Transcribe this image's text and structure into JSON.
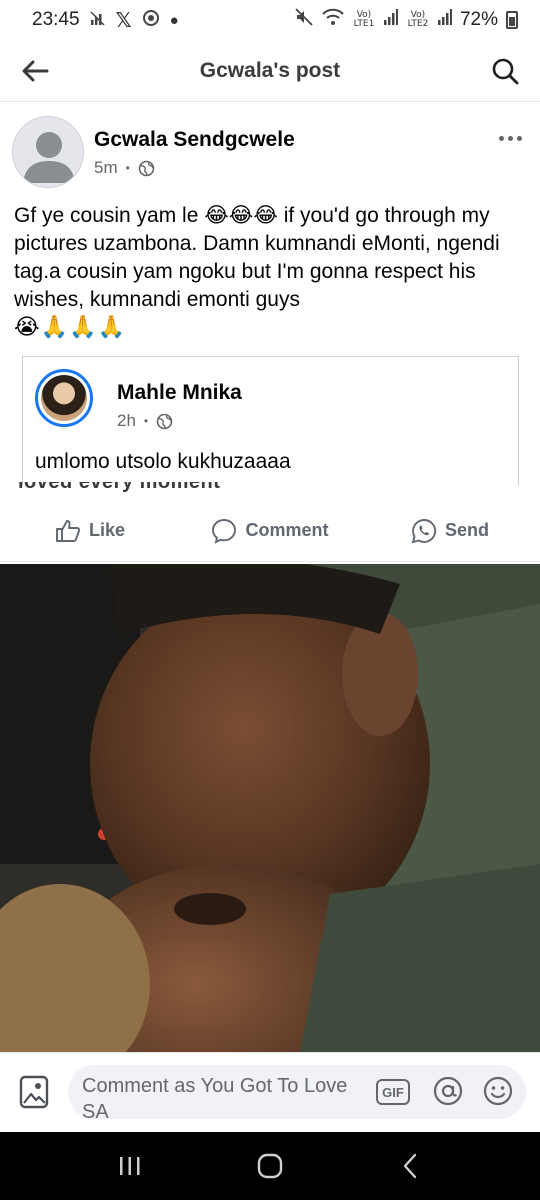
{
  "status_bar": {
    "time": "23:45",
    "battery": "72%",
    "signal1": "Vo) LTE1",
    "signal2": "Vo) LTE2",
    "left_icons": [
      "signal-off-icon",
      "x-logo-icon",
      "gallery-icon",
      "dot-icon"
    ],
    "right_icons": [
      "mute-icon",
      "wifi-icon",
      "signal-icon",
      "battery-icon"
    ]
  },
  "header": {
    "title": "Gcwala's post",
    "back_icon": "back-arrow-icon",
    "search_icon": "search-icon"
  },
  "post": {
    "author": "Gcwala Sendgcwele",
    "time": "5m",
    "separator": "•",
    "privacy_icon": "globe-icon",
    "text": "Gf ye cousin yam le 😂😂😂 if you'd go through my pictures uzambona. Damn kumnandi eMonti, ngendi tag.a cousin yam ngoku but I'm gonna respect his wishes, kumnandi emonti guys",
    "emojis": "😭🙏🙏🙏"
  },
  "shared_post": {
    "author": "Mahle Mnika",
    "time": "2h",
    "separator": "•",
    "text": "umlomo utsolo kukhuzaaaa",
    "cut_text": "loved every moment"
  },
  "actions": {
    "like": "Like",
    "comment": "Comment",
    "send": "Send"
  },
  "comment_bar": {
    "placeholder": "Comment as You Got To Love SA",
    "gif": "GIF"
  },
  "nav": {
    "recents_icon": "recents-icon",
    "home_icon": "home-icon",
    "back_icon": "nav-back-icon"
  },
  "colors": {
    "accent": "#1877f2",
    "text": "#050505",
    "secondary_text": "#65676b"
  }
}
